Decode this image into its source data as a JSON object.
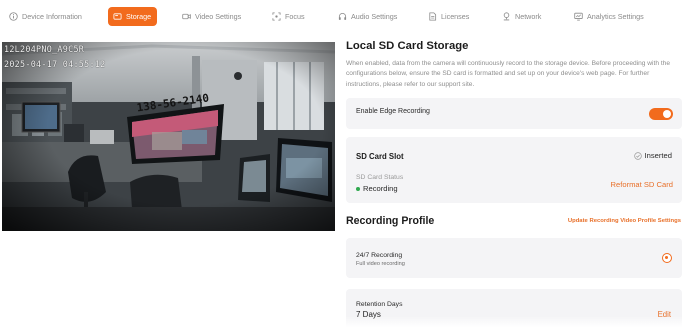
{
  "nav": {
    "tabs": [
      {
        "label": "Device Information",
        "icon": "info-icon"
      },
      {
        "label": "Storage",
        "icon": "storage-icon",
        "active": true
      },
      {
        "label": "Video Settings",
        "icon": "video-icon"
      },
      {
        "label": "Focus",
        "icon": "focus-icon"
      },
      {
        "label": "Audio Settings",
        "icon": "headphones-icon"
      },
      {
        "label": "Licenses",
        "icon": "license-icon"
      },
      {
        "label": "Network",
        "icon": "network-icon"
      },
      {
        "label": "Analytics Settings",
        "icon": "analytics-icon"
      }
    ]
  },
  "camera": {
    "osd_line1": "12L204PNO_A9C5R",
    "osd_line2": "2025-04-17 04:55:12",
    "screen_text": "138-56-2140"
  },
  "storage": {
    "title": "Local SD Card Storage",
    "description": "When enabled, data from the camera will continuously record to the storage device. Before proceeding with the configurations below, ensure the SD card is formatted and set up on your device's web page. For further instructions, please refer to our support site.",
    "edge_recording_label": "Enable Edge Recording",
    "edge_recording_enabled": true,
    "sd_slot_label": "SD Card Slot",
    "sd_slot_status": "Inserted",
    "sd_status_label": "SD Card Status",
    "sd_status_value": "Recording",
    "reformat_label": "Reformat SD Card"
  },
  "profile": {
    "title": "Recording Profile",
    "update_link": "Update Recording Video Profile Settings",
    "option_title": "24/7 Recording",
    "option_subtitle": "Full video recording",
    "option_selected": true,
    "retention_label": "Retention Days",
    "retention_value": "7 Days",
    "edit_label": "Edit"
  },
  "colors": {
    "accent": "#f26b1d",
    "status_green": "#2fa84f",
    "card_bg": "#f4f4f6"
  }
}
